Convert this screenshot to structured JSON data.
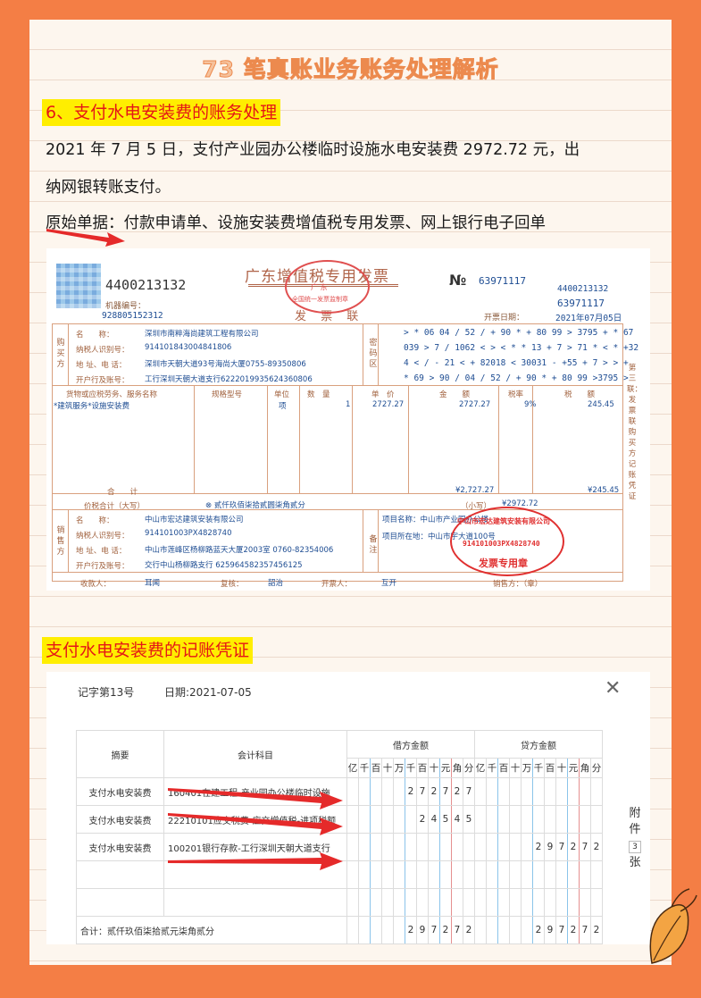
{
  "title": "73 笔真账业务账务处理解析",
  "section1": {
    "heading": "6、支付水电安装费的账务处理",
    "line1": "2021 年 7 月 5 日，支付产业园办公楼临时设施水电安装费 2972.72 元，出",
    "line2": "纳网银转账支付。",
    "line3": "原始单据：付款申请单、设施安装费增值税专用发票、网上银行电子回单"
  },
  "invoice": {
    "code_big": "4400213132",
    "machine_label": "机器编号：",
    "machine_no": "928805152312",
    "title": "广东增值税专用发票",
    "title_sub": "发 票 联",
    "no_label": "№",
    "no": "63971117",
    "code_right": "4400213132",
    "no_right": "63971117",
    "date_label": "开票日期：",
    "date": "2021年07月05日",
    "buyer_tag": "购买方",
    "buyer": {
      "name_label": "名　　称：",
      "name": "深圳市南粹海尚建筑工程有限公司",
      "tax_label": "纳税人识别号：",
      "tax": "914101843004841806",
      "addr_label": "地 址、电 话：",
      "addr": "深圳市天朝大道93号海尚大厦0755-89350806",
      "bank_label": "开户行及账号：",
      "bank": "工行深圳天朝大道支行6222019935624360806"
    },
    "cipher_tag": "密码区",
    "cipher": [
      "> * 06 04 / 52 / + 90 * + 80 99 > 3795 + * 67",
      "039 > 7 / 1062 < > < * * 13 + 7 > 71 * < * +32",
      "4 < / - 21 < + 82018 < 30031 - +55 + 7 > > +",
      "* 69 > 90 / 04 / 52 / + 90 * + 80 99 >3795 >"
    ],
    "cols": {
      "item": "货物或应税劳务、服务名称",
      "spec": "规格型号",
      "unit": "单位",
      "qty": "数　量",
      "price": "单　价",
      "amount": "金　　额",
      "rate": "税率",
      "tax": "税　　额"
    },
    "row": {
      "item": "*建筑服务*设施安装费",
      "unit": "项",
      "qty": "1",
      "price": "2727.27",
      "amount": "2727.27",
      "rate": "9%",
      "tax": "245.45"
    },
    "total_label": "合　　计",
    "total_amount": "¥2,727.27",
    "total_tax": "¥245.45",
    "grand_label": "价税合计（大写）",
    "grand_words": "⊗ 贰仟玖佰柒拾贰圆柒角贰分",
    "grand_small_label": "（小写）",
    "grand_small": "¥2972.72",
    "seller_tag": "销售方",
    "seller": {
      "name_label": "名　　称：",
      "name": "中山市宏达建筑安装有限公司",
      "tax_label": "纳税人识别号：",
      "tax": "914101003PX4828740",
      "addr_label": "地 址、电 话：",
      "addr": "中山市莲峰区杨柳路蓝天大厦2003室 0760-82354006",
      "bank_label": "开户行及账号：",
      "bank": "交行中山杨柳路支行 625964582357456125"
    },
    "remark_tag": "备注",
    "remark1": "项目名称：中山市产业园办公楼",
    "remark2": "项目所在地：中山市宇大道100号",
    "seal_text": "中山市宏达建筑安装有限公司",
    "seal_tax": "914101003PX4828740",
    "seal_label": "发票专用章",
    "top_seal_text": "全国统一发票监制章",
    "top_seal_sub": "广 东",
    "footer": {
      "payee_label": "收款人：",
      "payee": "耳闻",
      "review_label": "复核：",
      "review": "韶治",
      "drawer_label": "开票人：",
      "drawer": "互开",
      "seller_label": "销售方：（章）"
    },
    "side_label": "第三联：发票联　购买方记账凭证"
  },
  "section2": {
    "heading": "支付水电安装费的记账凭证"
  },
  "voucher": {
    "number": "记字第13号",
    "date": "日期:2021-07-05",
    "col_summary": "摘要",
    "col_account": "会计科目",
    "col_debit": "借方金额",
    "col_credit": "贷方金额",
    "units": [
      "亿",
      "千",
      "百",
      "十",
      "万",
      "千",
      "百",
      "十",
      "元",
      "角",
      "分"
    ],
    "rows": [
      {
        "summary": "支付水电安装费",
        "account": "160401在建工程-产业园办公楼临时设施",
        "debit": [
          "",
          "",
          "",
          "",
          "",
          "2",
          "7",
          "2",
          "7",
          "2",
          "7"
        ],
        "credit": [
          "",
          "",
          "",
          "",
          "",
          "",
          "",
          "",
          "",
          "",
          ""
        ]
      },
      {
        "summary": "支付水电安装费",
        "account": "22210101应交税费-应交增值税-进项税额",
        "debit": [
          "",
          "",
          "",
          "",
          "",
          "",
          "2",
          "4",
          "5",
          "4",
          "5"
        ],
        "credit": [
          "",
          "",
          "",
          "",
          "",
          "",
          "",
          "",
          "",
          "",
          ""
        ]
      },
      {
        "summary": "支付水电安装费",
        "account": "100201银行存款-工行深圳天朝大道支行",
        "debit": [
          "",
          "",
          "",
          "",
          "",
          "",
          "",
          "",
          "",
          "",
          ""
        ],
        "credit": [
          "",
          "",
          "",
          "",
          "",
          "2",
          "9",
          "7",
          "2",
          "7",
          "2"
        ]
      },
      {
        "summary": "",
        "account": "",
        "debit": [
          "",
          "",
          "",
          "",
          "",
          "",
          "",
          "",
          "",
          "",
          ""
        ],
        "credit": [
          "",
          "",
          "",
          "",
          "",
          "",
          "",
          "",
          "",
          "",
          ""
        ]
      },
      {
        "summary": "",
        "account": "",
        "debit": [
          "",
          "",
          "",
          "",
          "",
          "",
          "",
          "",
          "",
          "",
          ""
        ],
        "credit": [
          "",
          "",
          "",
          "",
          "",
          "",
          "",
          "",
          "",
          "",
          ""
        ]
      }
    ],
    "total_label": "合计：贰仟玖佰柒拾贰元柒角贰分",
    "total_debit": [
      "",
      "",
      "",
      "",
      "",
      "2",
      "9",
      "7",
      "2",
      "7",
      "2"
    ],
    "total_credit": [
      "",
      "",
      "",
      "",
      "",
      "2",
      "9",
      "7",
      "2",
      "7",
      "2"
    ],
    "attach1": "附",
    "attach2": "件",
    "attach_count": "3",
    "attach3": "张"
  }
}
